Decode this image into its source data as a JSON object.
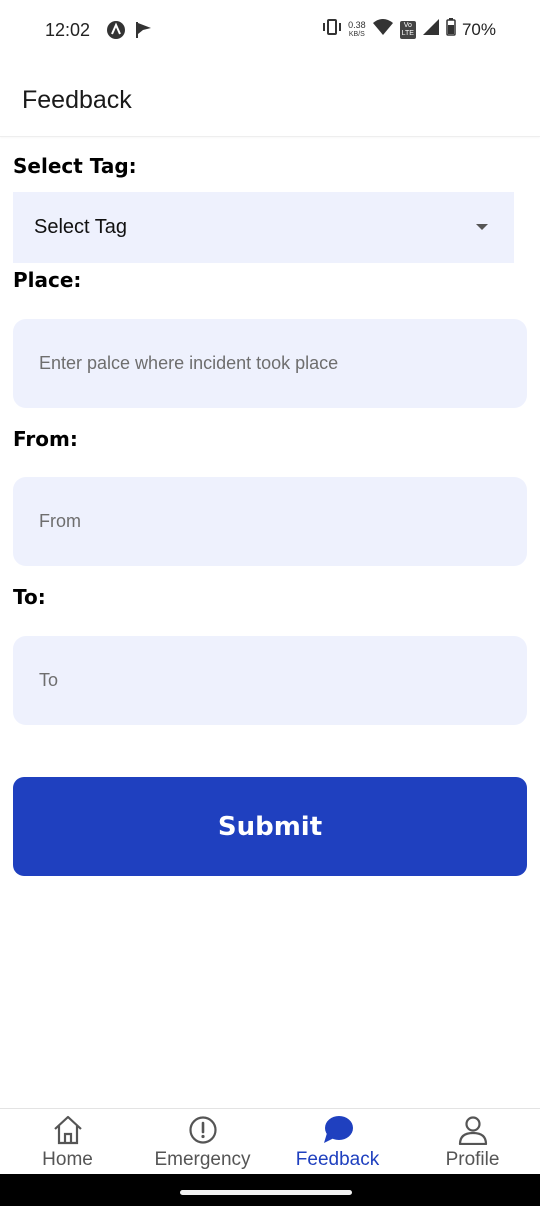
{
  "status_bar": {
    "time": "12:02",
    "net_speed_value": "0.38",
    "net_speed_unit": "KB/S",
    "volte_top": "Vo",
    "volte_bottom": "LTE",
    "battery": "70%"
  },
  "app_bar": {
    "title": "Feedback"
  },
  "form": {
    "tag_label": "Select Tag:",
    "tag_value": "Select Tag",
    "place_label": "Place:",
    "place_placeholder": "Enter palce where incident took place",
    "from_label": "From:",
    "from_placeholder": "From",
    "to_label": "To:",
    "to_placeholder": "To",
    "submit_label": "Submit"
  },
  "bottom_nav": {
    "items": [
      {
        "label": "Home",
        "icon": "home-icon"
      },
      {
        "label": "Emergency",
        "icon": "alert-circle-icon"
      },
      {
        "label": "Feedback",
        "icon": "chat-bubble-icon",
        "active": true
      },
      {
        "label": "Profile",
        "icon": "person-icon"
      }
    ]
  },
  "colors": {
    "accent": "#1f40bf",
    "field_background": "#eef1fd"
  }
}
